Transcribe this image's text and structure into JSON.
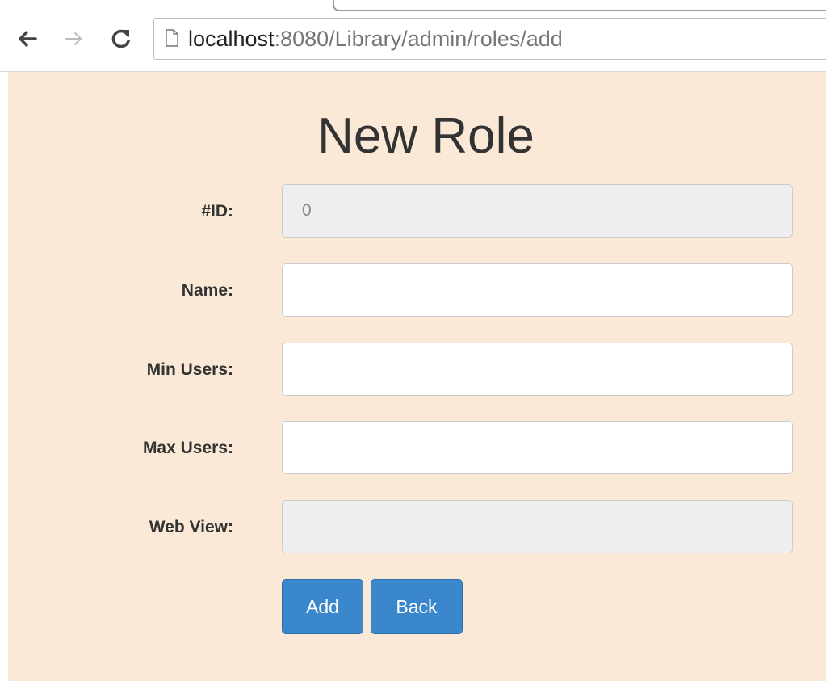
{
  "browser": {
    "url_host": "localhost",
    "url_rest": ":8080/Library/admin/roles/add"
  },
  "page": {
    "title": "New Role"
  },
  "form": {
    "id": {
      "label": "#ID:",
      "value": "0"
    },
    "name": {
      "label": "Name:",
      "value": ""
    },
    "min_users": {
      "label": "Min Users:",
      "value": ""
    },
    "max_users": {
      "label": "Max Users:",
      "value": ""
    },
    "web_view": {
      "label": "Web View:",
      "value": ""
    }
  },
  "buttons": {
    "add": "Add",
    "back": "Back"
  },
  "colors": {
    "page_background": "#fae9d6",
    "button_primary": "#3a87cc",
    "disabled_input": "#eeeeee"
  },
  "icons": {
    "back": "arrow-left-icon",
    "forward": "arrow-right-icon",
    "reload": "reload-icon",
    "page": "page-icon"
  }
}
